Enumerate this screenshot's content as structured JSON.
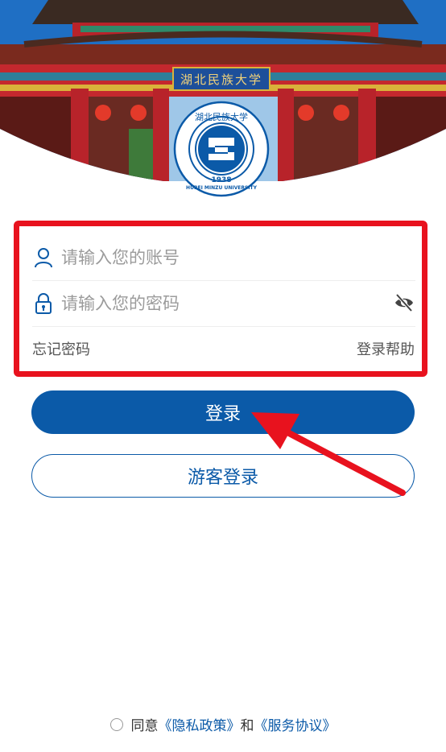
{
  "header": {
    "gate_plaque": "湖北民族大学",
    "logo": {
      "name_cn": "湖北民族大学",
      "name_en": "HUBEI MINZU UNIVERSITY",
      "year": "1938",
      "color": "#0b5aa8"
    }
  },
  "form": {
    "account_placeholder": "请输入您的账号",
    "password_placeholder": "请输入您的密码",
    "forgot_password": "忘记密码",
    "login_help": "登录帮助",
    "highlight_color": "#e8121e"
  },
  "buttons": {
    "login": "登录",
    "guest_login": "游客登录",
    "accent_color": "#0b5aa8"
  },
  "agreement": {
    "prefix": "同意",
    "privacy_policy": "《隐私政策》",
    "and": "和",
    "service_agreement": "《服务协议》"
  },
  "icons": [
    "user-icon",
    "lock-icon",
    "eye-off-icon",
    "red-arrow"
  ]
}
